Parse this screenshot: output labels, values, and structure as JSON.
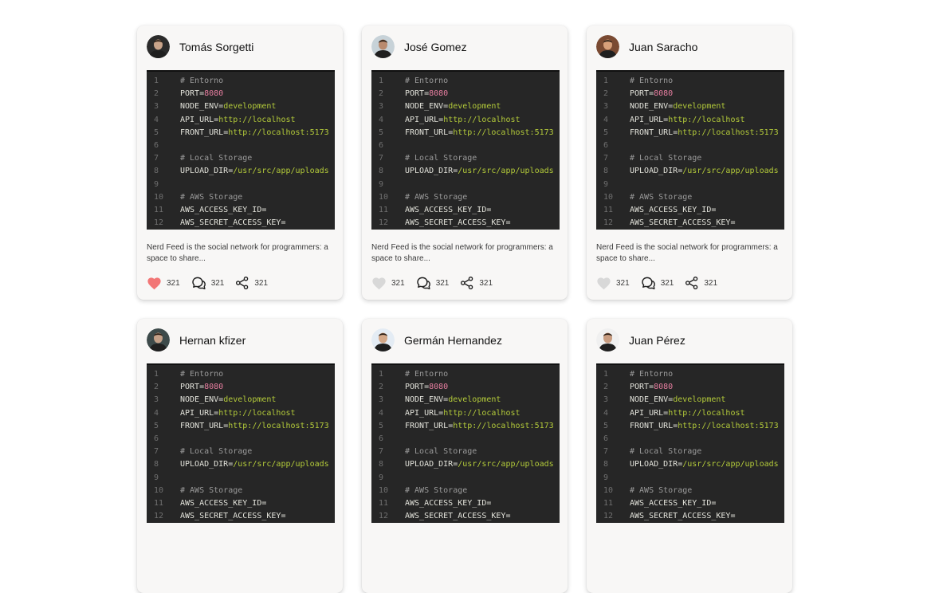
{
  "colors": {
    "heart_active": "#f27676",
    "heart_inactive": "#d8d8d8"
  },
  "posts": [
    {
      "author": "Tomás Sorgetti",
      "avatar_bg": "#2b2b2b",
      "avatar_skin": "#c9a48a",
      "liked": true,
      "description": "Nerd Feed is the social network for programmers: a space to share...",
      "likes": "321",
      "comments": "321",
      "shares": "321"
    },
    {
      "author": "José Gomez",
      "avatar_bg": "#c7d2d8",
      "avatar_skin": "#b98a6e",
      "liked": false,
      "description": "Nerd Feed is the social network for programmers: a space to share...",
      "likes": "321",
      "comments": "321",
      "shares": "321"
    },
    {
      "author": "Juan Saracho",
      "avatar_bg": "#7a4a32",
      "avatar_skin": "#d8a07a",
      "liked": false,
      "description": "Nerd Feed is the social network for programmers: a space to share...",
      "likes": "321",
      "comments": "321",
      "shares": "321"
    },
    {
      "author": "Hernan kfizer",
      "avatar_bg": "#3d4a4a",
      "avatar_skin": "#c4a088",
      "liked": null,
      "description": "",
      "likes": "",
      "comments": "",
      "shares": ""
    },
    {
      "author": "Germán Hernandez",
      "avatar_bg": "#e4ecf4",
      "avatar_skin": "#d4a888",
      "liked": null,
      "description": "",
      "likes": "",
      "comments": "",
      "shares": ""
    },
    {
      "author": "Juan Pérez",
      "avatar_bg": "#f0f0f0",
      "avatar_skin": "#c89c80",
      "liked": null,
      "description": "",
      "likes": "",
      "comments": "",
      "shares": ""
    }
  ],
  "code_lines": [
    {
      "n": "1",
      "parts": [
        {
          "t": "# Entorno",
          "c": "cm"
        }
      ]
    },
    {
      "n": "2",
      "parts": [
        {
          "t": "PORT",
          "c": "tx"
        },
        {
          "t": "=",
          "c": "tx"
        },
        {
          "t": "8080",
          "c": "num"
        }
      ]
    },
    {
      "n": "3",
      "parts": [
        {
          "t": "NODE_ENV",
          "c": "tx"
        },
        {
          "t": "=",
          "c": "tx"
        },
        {
          "t": "development",
          "c": "str"
        }
      ]
    },
    {
      "n": "4",
      "parts": [
        {
          "t": "API_URL",
          "c": "tx"
        },
        {
          "t": "=",
          "c": "tx"
        },
        {
          "t": "http://localhost",
          "c": "str"
        }
      ]
    },
    {
      "n": "5",
      "parts": [
        {
          "t": "FRONT_URL",
          "c": "tx"
        },
        {
          "t": "=",
          "c": "tx"
        },
        {
          "t": "http://localhost:5173",
          "c": "str"
        }
      ]
    },
    {
      "n": "6",
      "parts": []
    },
    {
      "n": "7",
      "parts": [
        {
          "t": "# Local Storage",
          "c": "cm"
        }
      ]
    },
    {
      "n": "8",
      "parts": [
        {
          "t": "UPLOAD_DIR",
          "c": "tx"
        },
        {
          "t": "=",
          "c": "tx"
        },
        {
          "t": "/usr/src/app/uploads",
          "c": "str"
        }
      ]
    },
    {
      "n": "9",
      "parts": []
    },
    {
      "n": "10",
      "parts": [
        {
          "t": "# AWS Storage",
          "c": "cm"
        }
      ]
    },
    {
      "n": "11",
      "parts": [
        {
          "t": "AWS_ACCESS_KEY_ID",
          "c": "tx"
        },
        {
          "t": "=",
          "c": "tx"
        }
      ]
    },
    {
      "n": "12",
      "parts": [
        {
          "t": "AWS_SECRET_ACCESS_KEY",
          "c": "tx"
        },
        {
          "t": "=",
          "c": "tx"
        }
      ]
    }
  ]
}
